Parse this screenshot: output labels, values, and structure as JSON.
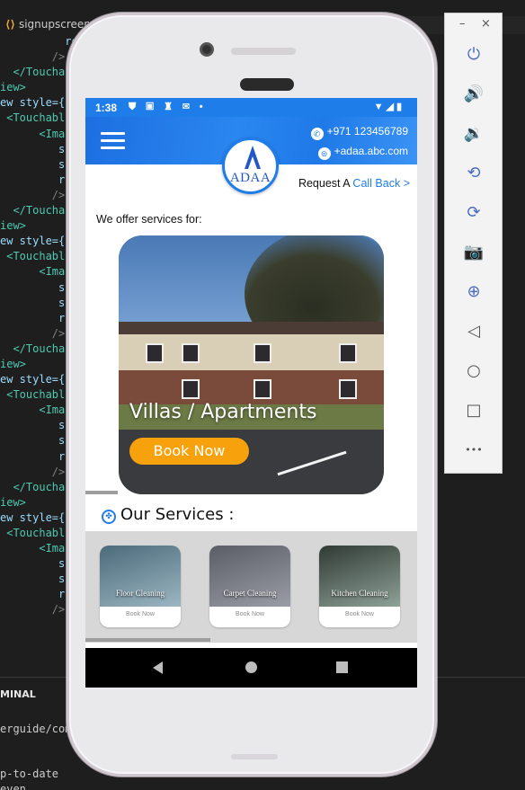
{
  "editor": {
    "tab_title": "signupscreen",
    "code_lines": [
      {
        "indent": "          ",
        "text": "re",
        "cls": "kw"
      },
      {
        "indent": "        ",
        "text": "/>",
        "cls": "punct"
      },
      {
        "indent": "  ",
        "text": "</Touchab",
        "cls": "tag"
      },
      {
        "indent": "",
        "text": "iew>",
        "cls": "tag"
      },
      {
        "indent": "",
        "text": "ew style={",
        "cls": "kw"
      },
      {
        "indent": " ",
        "text": "<Touchabl",
        "cls": "tag"
      },
      {
        "indent": "      ",
        "text": "<Imag",
        "cls": "tag"
      },
      {
        "indent": "         ",
        "text": "s",
        "cls": "kw"
      },
      {
        "indent": "         ",
        "text": "s",
        "cls": "kw"
      },
      {
        "indent": "         ",
        "text": "r",
        "cls": "kw"
      },
      {
        "indent": "        ",
        "text": "/>",
        "cls": "punct"
      },
      {
        "indent": "  ",
        "text": "</Touchab",
        "cls": "tag"
      },
      {
        "indent": "",
        "text": "iew>",
        "cls": "tag"
      },
      {
        "indent": "",
        "text": "ew style={",
        "cls": "kw"
      },
      {
        "indent": " ",
        "text": "<Touchabl",
        "cls": "tag"
      },
      {
        "indent": "      ",
        "text": "<Imag",
        "cls": "tag"
      },
      {
        "indent": "         ",
        "text": "s",
        "cls": "kw"
      },
      {
        "indent": "         ",
        "text": "s",
        "cls": "kw"
      },
      {
        "indent": "         ",
        "text": "r",
        "cls": "kw"
      },
      {
        "indent": "        ",
        "text": "/>",
        "cls": "punct"
      },
      {
        "indent": "  ",
        "text": "</Touchab",
        "cls": "tag"
      },
      {
        "indent": "",
        "text": "iew>",
        "cls": "tag"
      },
      {
        "indent": "",
        "text": "ew style={",
        "cls": "kw"
      },
      {
        "indent": " ",
        "text": "<Touchabl",
        "cls": "tag"
      },
      {
        "indent": "      ",
        "text": "<Imag",
        "cls": "tag"
      },
      {
        "indent": "         ",
        "text": "s",
        "cls": "kw"
      },
      {
        "indent": "         ",
        "text": "s",
        "cls": "kw"
      },
      {
        "indent": "         ",
        "text": "r",
        "cls": "kw"
      },
      {
        "indent": "        ",
        "text": "/>",
        "cls": "punct"
      },
      {
        "indent": "  ",
        "text": "</Touchab",
        "cls": "tag"
      },
      {
        "indent": "",
        "text": "iew>",
        "cls": "tag"
      },
      {
        "indent": "",
        "text": "ew style={",
        "cls": "kw"
      },
      {
        "indent": " ",
        "text": "<Touchabl",
        "cls": "tag"
      },
      {
        "indent": "      ",
        "text": "<Imag",
        "cls": "tag"
      },
      {
        "indent": "         ",
        "text": "s",
        "cls": "kw"
      },
      {
        "indent": "         ",
        "text": "s",
        "cls": "kw"
      },
      {
        "indent": "         ",
        "text": "r",
        "cls": "kw"
      },
      {
        "indent": "        ",
        "text": "/>",
        "cls": "punct"
      }
    ],
    "terminal_header": "MINAL",
    "terminal_lines": [
      "erguide/comm",
      "p-to-date",
      "  even"
    ]
  },
  "status_bar": {
    "time": "1:38",
    "left_icons": "⛊ ▣ ♜ ✉ •",
    "right_icons": "▼◢▮"
  },
  "header": {
    "phone": "+971 123456789",
    "website": "+adaa.abc.com",
    "logo_text": "ADAA"
  },
  "callback": {
    "prefix": "Request A",
    "link": "Call Back >"
  },
  "offer_text": "We offer services for:",
  "hero": {
    "title": "Villas / Apartments",
    "button": "Book Now"
  },
  "services": {
    "title": "Our Services :",
    "cards": [
      {
        "label": "Floor Cleaning",
        "button": "Book Now",
        "colors": [
          "#4b6a7a",
          "#9cb6c2"
        ]
      },
      {
        "label": "Carpet Cleaning",
        "button": "Book Now",
        "colors": [
          "#5a5d66",
          "#9a9da6"
        ]
      },
      {
        "label": "Kitchen Cleaning",
        "button": "Book Now",
        "colors": [
          "#2f3a33",
          "#8fa198"
        ]
      }
    ]
  },
  "colors": {
    "brand_blue": "#1f7de9",
    "accent_orange": "#f7a20c"
  },
  "emulator_toolbar": {
    "minimize": "–",
    "close": "×",
    "buttons": [
      {
        "name": "power-icon",
        "glyph": "⏻"
      },
      {
        "name": "volume-up-icon",
        "glyph": "🔊"
      },
      {
        "name": "volume-down-icon",
        "glyph": "🔉"
      },
      {
        "name": "rotate-left-icon",
        "glyph": "⟲"
      },
      {
        "name": "rotate-right-icon",
        "glyph": "⟳"
      },
      {
        "name": "camera-icon",
        "glyph": "📷"
      },
      {
        "name": "zoom-icon",
        "glyph": "⊕"
      },
      {
        "name": "back-icon",
        "glyph": "◁"
      },
      {
        "name": "home-icon",
        "glyph": "○"
      },
      {
        "name": "overview-icon",
        "glyph": "□"
      },
      {
        "name": "more-icon",
        "glyph": "•••"
      }
    ]
  }
}
